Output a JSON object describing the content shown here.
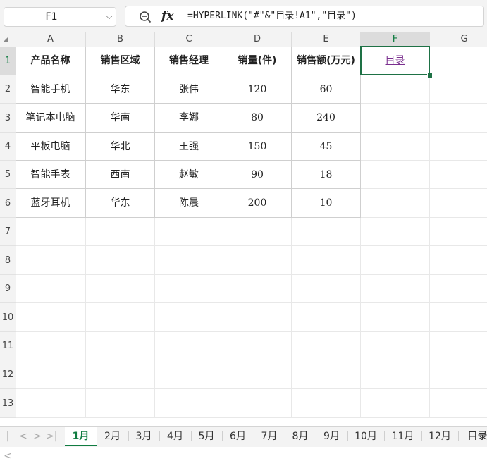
{
  "name_box": {
    "value": "F1"
  },
  "formula_bar": {
    "fx_label": "fx",
    "formula": "=HYPERLINK(\"#\"&\"目录!A1\",\"目录\")"
  },
  "columns": [
    "A",
    "B",
    "C",
    "D",
    "E",
    "F",
    "G"
  ],
  "rows": [
    "1",
    "2",
    "3",
    "4",
    "5",
    "6",
    "7",
    "8",
    "9",
    "10",
    "11",
    "12",
    "13"
  ],
  "active_cell": "F1",
  "table": {
    "headers": [
      "产品名称",
      "销售区域",
      "销售经理",
      "销量(件)",
      "销售额(万元)"
    ],
    "rows": [
      [
        "智能手机",
        "华东",
        "张伟",
        "120",
        "60"
      ],
      [
        "笔记本电脑",
        "华南",
        "李娜",
        "80",
        "240"
      ],
      [
        "平板电脑",
        "华北",
        "王强",
        "150",
        "45"
      ],
      [
        "智能手表",
        "西南",
        "赵敏",
        "90",
        "18"
      ],
      [
        "蓝牙耳机",
        "华东",
        "陈晨",
        "200",
        "10"
      ]
    ]
  },
  "hyperlink_cell": {
    "text": "目录"
  },
  "sheet_tabs": [
    "1月",
    "2月",
    "3月",
    "4月",
    "5月",
    "6月",
    "7月",
    "8月",
    "9月",
    "10月",
    "11月",
    "12月",
    "目录"
  ],
  "active_sheet": "1月",
  "nav_buttons": [
    "|<",
    "<",
    ">",
    ">|"
  ],
  "colors": {
    "accent": "#107c41",
    "link": "#7b2f8f"
  }
}
